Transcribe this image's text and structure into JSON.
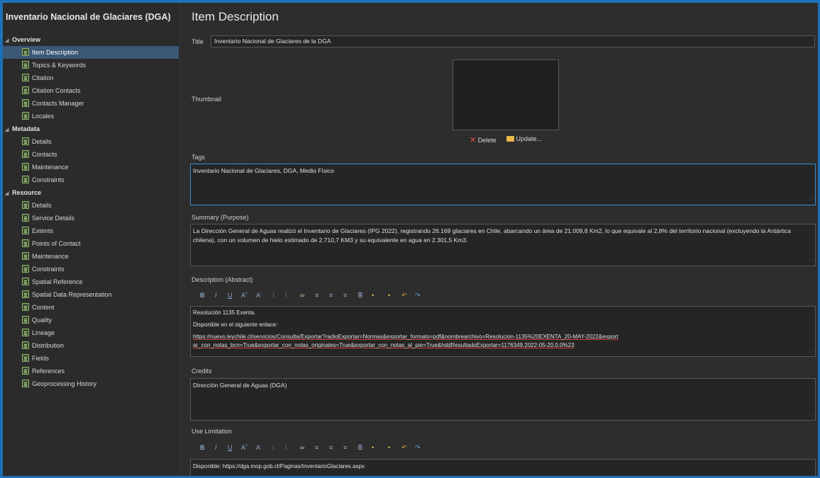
{
  "app_title": "Inventario Nacional de Glaciares (DGA)",
  "page_title": "Item Description",
  "tree": [
    {
      "group": "Overview",
      "items": [
        "Item Description",
        "Topics & Keywords",
        "Citation",
        "Citation Contacts",
        "Contacts Manager",
        "Locales"
      ]
    },
    {
      "group": "Metadata",
      "items": [
        "Details",
        "Contacts",
        "Maintenance",
        "Constraints"
      ]
    },
    {
      "group": "Resource",
      "items": [
        "Details",
        "Service Details",
        "Extents",
        "Points of Contact",
        "Maintenance",
        "Constraints",
        "Spatial Reference",
        "Spatial Data Representation",
        "Content",
        "Quality",
        "Lineage",
        "Distribution",
        "Fields",
        "References",
        "Geoprocessing History"
      ]
    }
  ],
  "selected_item": "Item Description",
  "form": {
    "title_label": "Title",
    "title_value": "Inventario Nacional de Glaciares de la DGA",
    "thumbnail_label": "Thumbnail",
    "delete_label": "Delete",
    "update_label": "Update...",
    "tags_label": "Tags",
    "tags_value": "Inventario Nacional de Glaciares, DGA, Medio Físico",
    "summary_label": "Summary (Purpose)",
    "summary_value": "La Dirección General de Aguas realizó el Inventario de Glaciares (IPG 2022), registrando 26.169 glaciares en Chile, abarcando un área de 21.009,8 Km2, lo que equivale al 2,8% del territorio nacional (excluyendo la Antártica chilena), con un volumen de hielo estimado de 2.710,7 KM3 y su equivalente en agua en 2.301,5 Km3.",
    "description_label": "Description (Abstract)",
    "description_line1": "Resolución 1135 Exenta.",
    "description_line2": "Disponible en el siguiente enlace:",
    "description_line3": "https://nuevo.leychile.cl/servicios/Consulta/Exportar?radioExportar=Normas&exportar_formato=pdf&nombrearchivo=Resolucion-1135%20EXENTA_20-MAY-2022&exportar_con_notas_bcn=True&exportar_con_notas_originales=True&exportar_con_notas_al_pie=True&hddResultadoExportar=1176349.2022-05-20.0.0%23",
    "credits_label": "Credits",
    "credits_value": "Dirección General de Aguas (DGA)",
    "use_limitation_label": "Use Limitation",
    "use_limitation_value": "Disponible: https://dga.mop.gob.cl/Paginas/InventarioGlaciares.aspx"
  },
  "toolbar_icons": [
    "bold-icon",
    "italic-icon",
    "underline-icon",
    "font-grow-icon",
    "font-shrink-icon",
    "bullet-list-icon",
    "numbered-list-icon",
    "link-icon",
    "align-left-icon",
    "align-center-icon",
    "align-right-icon",
    "justify-icon",
    "insert-icon",
    "clear-icon",
    "undo-icon",
    "redo-icon"
  ],
  "colors": {
    "accent": "#3c8ec9",
    "selection": "#3b5877",
    "background": "#2d2d2d"
  }
}
